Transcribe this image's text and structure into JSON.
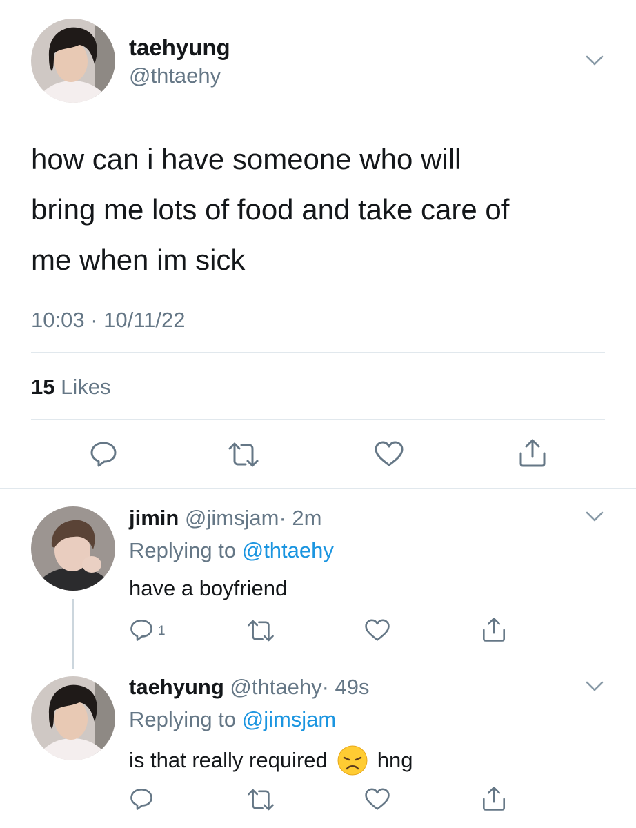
{
  "main_tweet": {
    "name": "taehyung",
    "handle": "@thtaehy",
    "text_line1": "how can i have someone who will",
    "text_line2": "bring me lots of food and take care of",
    "text_line3": "me when im sick",
    "timestamp": "10:03 · 10/11/22",
    "likes_count": "15",
    "likes_label": "Likes"
  },
  "reply1": {
    "name": "jimin",
    "handle": "@jimsjam",
    "time": "· 2m",
    "replying_prefix": "Replying to",
    "replying_to": "@thtaehy",
    "text": "have a boyfriend",
    "reply_count": "1"
  },
  "reply2": {
    "name": "taehyung",
    "handle": "@thtaehy",
    "time": "· 49s",
    "replying_prefix": "Replying to",
    "replying_to": "@jimsjam",
    "text": "is that really required",
    "text_after_emoji": "hng",
    "emoji": "disappointed-face"
  },
  "colors": {
    "link_blue": "#1b95e0",
    "secondary_grey": "#657786",
    "icon_grey": "#657786",
    "divider": "#e1e8ed"
  }
}
